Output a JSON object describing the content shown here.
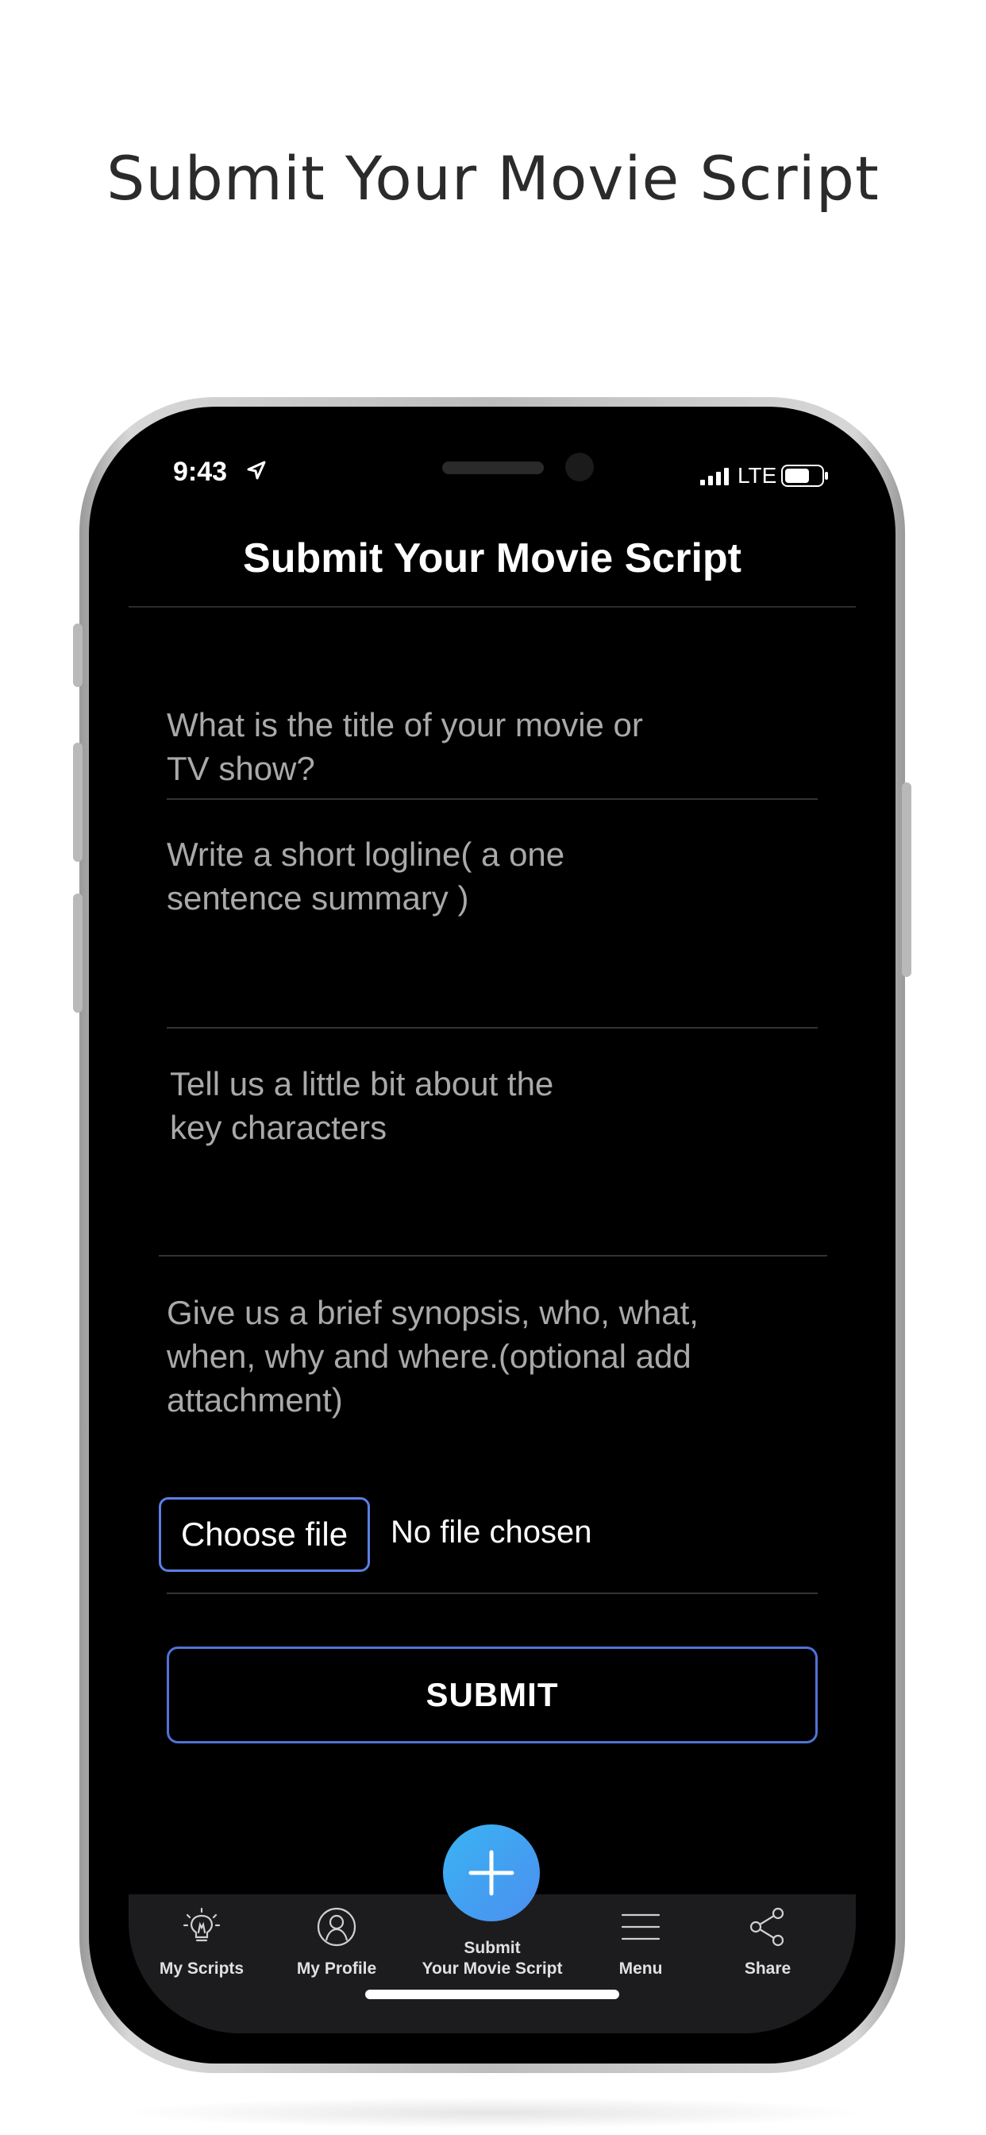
{
  "promo": {
    "title": "Submit Your Movie Script"
  },
  "status_bar": {
    "time": "9:43",
    "network": "LTE"
  },
  "header": {
    "title": "Submit Your Movie Script"
  },
  "form": {
    "title_field": {
      "line1": "What is the title of your movie or",
      "line2": "TV show?"
    },
    "logline_field": {
      "line1": "Write a short logline( a one",
      "line2": "sentence summary )"
    },
    "characters_field": {
      "line1": "Tell us a little bit about the",
      "line2": "key characters"
    },
    "synopsis_field": {
      "line1": "Give us a brief synopsis, who, what,",
      "line2": "when, why and where.(optional add",
      "line3": "attachment)"
    },
    "file_input": {
      "button_label": "Choose file",
      "status": "No file chosen"
    },
    "submit_label": "SUBMIT"
  },
  "tab_bar": {
    "items": [
      {
        "label": "My Scripts",
        "icon": "lightbulb-icon"
      },
      {
        "label": "My Profile",
        "icon": "profile-icon"
      },
      {
        "label_line1": "Submit",
        "label_line2": "Your Movie Script",
        "icon": "plus-icon"
      },
      {
        "label": "Menu",
        "icon": "hamburger-menu-icon"
      },
      {
        "label": "Share",
        "icon": "share-icon"
      }
    ]
  },
  "colors": {
    "accent_border": "#5b7fe6",
    "fab_start": "#3ab3f3",
    "fab_end": "#4b8fef",
    "screen_bg": "#000000",
    "tab_bar_bg": "#1c1c1e"
  }
}
